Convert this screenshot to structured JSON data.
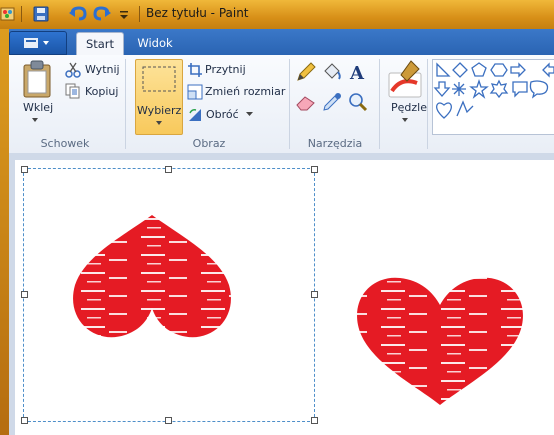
{
  "window": {
    "title": "Bez tytułu - Paint"
  },
  "tabs": [
    {
      "label": "Start",
      "active": true
    },
    {
      "label": "Widok",
      "active": false
    }
  ],
  "clipboard": {
    "paste_label": "Wklej",
    "cut_label": "Wytnij",
    "copy_label": "Kopiuj",
    "group_label": "Schowek"
  },
  "image": {
    "select_label": "Wybierz",
    "crop_label": "Przytnij",
    "resize_label": "Zmień rozmiar",
    "rotate_label": "Obróć",
    "group_label": "Obraz"
  },
  "tools": {
    "group_label": "Narzędzia"
  },
  "brushes": {
    "label": "Pędzle"
  },
  "colors": {
    "heart": "#e51b24",
    "selection": "#4f8fc9",
    "ribbon_tab": "#2a64b3"
  }
}
